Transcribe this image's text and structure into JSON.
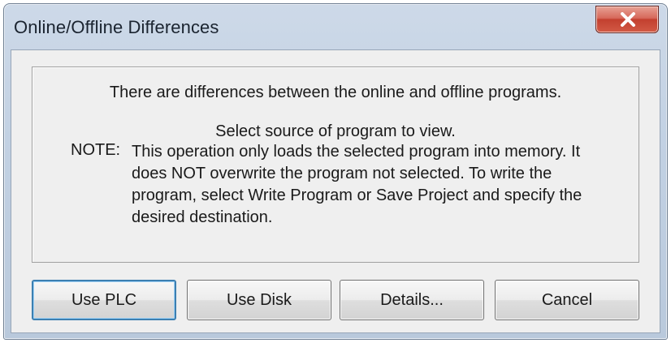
{
  "window": {
    "title": "Online/Offline Differences"
  },
  "message": {
    "line1": "There are differences between the online and offline programs.",
    "line2": "Select source of program to view.",
    "note_label": "NOTE:",
    "note_text": "This operation only loads the selected program into memory. It does NOT overwrite the program not selected. To write the program, select Write Program or Save Project and specify the desired destination."
  },
  "buttons": {
    "use_plc": "Use PLC",
    "use_disk": "Use Disk",
    "details": "Details...",
    "cancel": "Cancel"
  },
  "icons": {
    "close": "close-icon"
  }
}
